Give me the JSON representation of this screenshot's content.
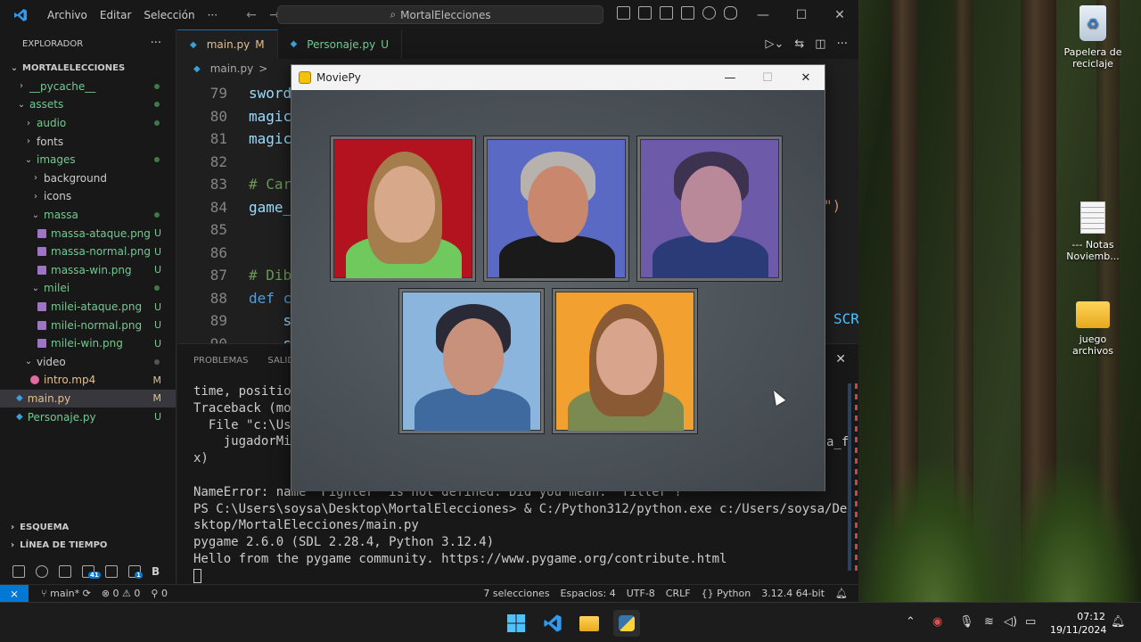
{
  "titlebar": {
    "menus": [
      "Archivo",
      "Editar",
      "Selección",
      "···"
    ],
    "search": "MortalElecciones"
  },
  "sidebar": {
    "title": "EXPLORADOR",
    "project": "MORTALELECCIONES",
    "items": [
      {
        "label": "__pycache__",
        "type": "folder",
        "open": false,
        "indent": 1,
        "color": "green",
        "marker": "dot"
      },
      {
        "label": "assets",
        "type": "folder",
        "open": true,
        "indent": 1,
        "color": "green",
        "marker": "dot"
      },
      {
        "label": "audio",
        "type": "folder",
        "open": false,
        "indent": 2,
        "color": "green",
        "marker": "dot"
      },
      {
        "label": "fonts",
        "type": "folder",
        "open": false,
        "indent": 2,
        "color": "normal",
        "marker": ""
      },
      {
        "label": "images",
        "type": "folder",
        "open": true,
        "indent": 2,
        "color": "green",
        "marker": "dot"
      },
      {
        "label": "background",
        "type": "folder",
        "open": false,
        "indent": 3,
        "color": "normal",
        "marker": ""
      },
      {
        "label": "icons",
        "type": "folder",
        "open": false,
        "indent": 3,
        "color": "normal",
        "marker": ""
      },
      {
        "label": "massa",
        "type": "folder",
        "open": true,
        "indent": 3,
        "color": "green",
        "marker": "dot"
      },
      {
        "label": "massa-ataque.png",
        "type": "image",
        "indent": 4,
        "color": "green",
        "marker": "U"
      },
      {
        "label": "massa-normal.png",
        "type": "image",
        "indent": 4,
        "color": "green",
        "marker": "U"
      },
      {
        "label": "massa-win.png",
        "type": "image",
        "indent": 4,
        "color": "green",
        "marker": "U"
      },
      {
        "label": "milei",
        "type": "folder",
        "open": true,
        "indent": 3,
        "color": "green",
        "marker": "dot"
      },
      {
        "label": "milei-ataque.png",
        "type": "image",
        "indent": 4,
        "color": "green",
        "marker": "U"
      },
      {
        "label": "milei-normal.png",
        "type": "image",
        "indent": 4,
        "color": "green",
        "marker": "U"
      },
      {
        "label": "milei-win.png",
        "type": "image",
        "indent": 4,
        "color": "green",
        "marker": "U"
      },
      {
        "label": "video",
        "type": "folder",
        "open": true,
        "indent": 2,
        "color": "normal",
        "marker": "dot-gray"
      },
      {
        "label": "intro.mp4",
        "type": "video",
        "indent": 3,
        "color": "orange",
        "marker": "M"
      },
      {
        "label": "main.py",
        "type": "python",
        "indent": 1,
        "color": "orange",
        "marker": "M",
        "selected": true
      },
      {
        "label": "Personaje.py",
        "type": "python",
        "indent": 1,
        "color": "green",
        "marker": "U"
      }
    ],
    "sections": [
      "ESQUEMA",
      "LÍNEA DE TIEMPO"
    ],
    "activity_badge": "41",
    "activity_badge2": "1",
    "activity_letter": "B"
  },
  "tabs": [
    {
      "label": "main.py",
      "marker": "M",
      "active": true
    },
    {
      "label": "Personaje.py",
      "marker": "U",
      "active": false
    }
  ],
  "breadcrumb": {
    "file": "main.py",
    "sep": ">"
  },
  "code": [
    {
      "ln": "79",
      "text": "sword"
    },
    {
      "ln": "80",
      "text": "magic"
    },
    {
      "ln": "81",
      "text": "magic"
    },
    {
      "ln": "82",
      "text": ""
    },
    {
      "ln": "83",
      "text": "# Car"
    },
    {
      "ln": "84",
      "text": "game_"
    },
    {
      "ln": "85",
      "text": ""
    },
    {
      "ln": "86",
      "text": ""
    },
    {
      "ln": "87",
      "text": "# Dib"
    },
    {
      "ln": "88",
      "text": "def c"
    },
    {
      "ln": "89",
      "text": "    s"
    },
    {
      "ln": "90",
      "text": "    s"
    }
  ],
  "code_right_frag": "\")",
  "code_right_frag2": "SCR",
  "panel": {
    "tabs": [
      "PROBLEMAS",
      "SALIDA"
    ],
    "terminal": [
      "time, positio",
      "Traceback (mo",
      "  File \"c:\\Us",
      "    jugadorMi",
      "x)",
      "",
      "NameError: name 'Fighter' is not defined. Did you mean: 'filter'?",
      "PS C:\\Users\\soysa\\Desktop\\MortalElecciones> & C:/Python312/python.exe c:/Users/soysa/De",
      "sktop/MortalElecciones/main.py",
      "pygame 2.6.0 (SDL 2.28.4, Python 3.12.4)",
      "Hello from the pygame community. https://www.pygame.org/contribute.html"
    ],
    "right_frag": "a_f"
  },
  "statusbar": {
    "branch": "main*",
    "errors": "0",
    "warnings": "0",
    "ports": "0",
    "selections": "7 selecciones",
    "spaces": "Espacios: 4",
    "encoding": "UTF-8",
    "eol": "CRLF",
    "language": "Python",
    "interpreter": "3.12.4 64-bit"
  },
  "moviepy": {
    "title": "MoviePy",
    "portraits": [
      {
        "bg": "#b3121f",
        "skin": "#d7a98a",
        "hair": "#a57c4c",
        "body": "#6fc95d"
      },
      {
        "bg": "#5a6ac4",
        "skin": "#c9876d",
        "hair": "#b7b2ad",
        "body": "#1a1a1a"
      },
      {
        "bg": "#6d5aa8",
        "skin": "#b9899a",
        "hair": "#3d3350",
        "body": "#2b3b77"
      },
      {
        "bg": "#8bb5dc",
        "skin": "#c8917b",
        "hair": "#2a2a36",
        "body": "#3f6aa0"
      },
      {
        "bg": "#f2a030",
        "skin": "#d8a48c",
        "hair": "#8a5a34",
        "body": "#7a8a50"
      }
    ]
  },
  "desktop": {
    "icons": [
      {
        "label": "Papelera de reciclaje"
      },
      {
        "label": "--- Notas Noviemb..."
      },
      {
        "label": "juego archivos"
      }
    ]
  },
  "taskbar": {
    "time": "07:12",
    "date": "19/11/2024"
  },
  "colors": {
    "accent": "#0078d4",
    "git_untracked": "#73c991",
    "git_modified": "#e2c08d"
  }
}
